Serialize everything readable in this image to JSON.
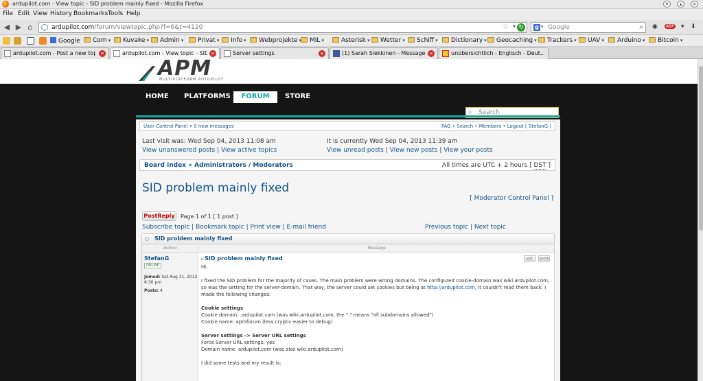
{
  "window": {
    "title": "ardupilot.com - View topic - SID problem mainly fixed - Mozilla Firefox"
  },
  "menu": [
    "File",
    "Edit",
    "View",
    "History",
    "Bookmarks",
    "Tools",
    "Help"
  ],
  "navbar": {
    "url_host": "ardupilot.com",
    "url_path": "/forum/viewtopic.php?f=6&t=4120",
    "search_placeholder": "Google",
    "ext_badge": "ABP"
  },
  "bookmarks": [
    "Google",
    "Com",
    "Kuvake",
    "Admin",
    "Privat",
    "Info",
    "Webprojekte",
    "MIL",
    "Asterisk",
    "Wetter",
    "Schiff",
    "Dictionary",
    "Geocaching",
    "Trackers",
    "UAV",
    "Arduino",
    "Bitcoin"
  ],
  "tabs": [
    {
      "label": "ardupilot.com - Post a new topic",
      "active": false
    },
    {
      "label": "ardupilot.com - View topic - SID ...",
      "active": true
    },
    {
      "label": "Server settings",
      "active": false
    },
    {
      "label": "(1) Sarah Siekkinen - Messages",
      "active": false
    },
    {
      "label": "unübersichtlich - Englisch - Deut...",
      "active": false
    }
  ],
  "site": {
    "logo": "APM",
    "logo_sub": "MULTIPLATFORM AUTOPILOT",
    "nav": [
      "HOME",
      "PLATFORMS",
      "FORUM",
      "STORE"
    ],
    "active_nav": "FORUM",
    "search_placeholder": "Search"
  },
  "forum": {
    "ucp_left": "User Control Panel • 0 new messages",
    "ucp_right": "FAQ • Search • Members • Logout [ StefanG ]",
    "last_visit": "Last visit was: Wed Sep 04, 2013 11:08 am",
    "current_time": "It is currently Wed Sep 04, 2013 11:39 am",
    "view_unanswered": "View unanswered posts",
    "view_active": "View active topics",
    "view_unread": "View unread posts",
    "view_new": "View new posts",
    "view_your": "View your posts",
    "breadcrumb": "Board index » Administrators / Moderators",
    "timezone_prefix": "All times are UTC + 2 hours [",
    "timezone_dst": "DST",
    "timezone_suffix": "]",
    "topic_title": "SID problem mainly fixed",
    "mod_cp": "[ Moderator Control Panel ]",
    "post_reply": "PostReply",
    "page_info": "Page 1 of 1   [ 1 post ]",
    "subscribe": "Subscribe topic",
    "bookmark": "Bookmark topic",
    "print": "Print view",
    "email": "E-mail friend",
    "previous": "Previous topic",
    "next": "Next topic",
    "box_title": "SID problem mainly fixed",
    "col_author": "Author",
    "col_message": "Message",
    "author": "StefanG",
    "author_status": "ONLINE",
    "joined_label": "Joined:",
    "joined_value": "Sat Aug 31, 2013 6:30 pm",
    "posts_label": "Posts:",
    "posts_value": "4",
    "post_title": "SID problem mainly fixed",
    "btn_edit": "EDIT",
    "btn_quote": "QUOTE",
    "msg_greeting": "Hi,",
    "msg_p1a": "I fixed the SID problem for the majority of cases. The main problem were wrong domains. The configured cookie-domain was wiki.ardupilot.com, so was the setting for the server-domain. That way, the server could set cookies but being at ",
    "msg_p1_link": "http://ardupilot.com",
    "msg_p1b": ", it couldn't read them back. I made the following changes:",
    "cookie_head": "Cookie settings",
    "cookie_l1": "Cookie domain: .ardupilot.com (was wiki.ardupilot.com, the \".\" means \"all subdomains allowed\")",
    "cookie_l2": "Cookie name: apmforum (less cryptic-easier to debug)",
    "server_head": "Server settings -> Server URL settings",
    "server_l1": "Force Server URL settings: yes",
    "server_l2": "Domain name: ardupilot.com (was also wiki.ardupilot.com)",
    "msg_last": "I did some tests and my result is:"
  }
}
